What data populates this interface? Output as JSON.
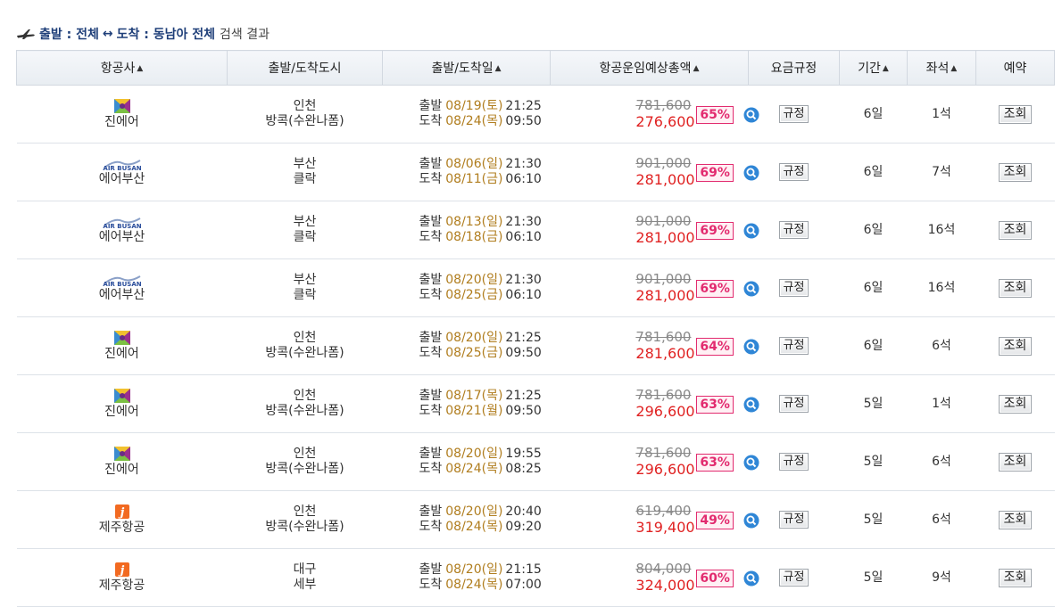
{
  "caption": {
    "departure_label": "출발 : 전체",
    "arrow": "↔",
    "arrival_label": "도착 : 동남아 전체",
    "suffix": "검색 결과"
  },
  "columns": [
    {
      "label": "항공사",
      "sortable": true
    },
    {
      "label": "출발/도착도시",
      "sortable": false
    },
    {
      "label": "출발/도착일",
      "sortable": true
    },
    {
      "label": "항공운임예상총액",
      "sortable": true
    },
    {
      "label": "요금규정",
      "sortable": false
    },
    {
      "label": "기간",
      "sortable": true
    },
    {
      "label": "좌석",
      "sortable": true
    },
    {
      "label": "예약",
      "sortable": false
    }
  ],
  "labels": {
    "depart": "출발",
    "arrive": "도착",
    "rule_button": "규정",
    "view_button": "조회",
    "sort_arrow": "▲"
  },
  "colors": {
    "discount_border": "#e22b6f",
    "final_price": "#e02222",
    "date": "#b07d1e",
    "caption_highlight": "#1f3f79"
  },
  "rows": [
    {
      "airline": "진에어",
      "logo": "jinair-logo",
      "from_city": "인천",
      "to_city": "방콕(수완나폼)",
      "dep_date": "08/19(토)",
      "dep_time": "21:25",
      "arr_date": "08/24(목)",
      "arr_time": "09:50",
      "orig_price": "781,600",
      "price": "276,600",
      "discount": "65%",
      "duration": "6일",
      "seats": "1석"
    },
    {
      "airline": "에어부산",
      "logo": "airbusan-logo",
      "from_city": "부산",
      "to_city": "클락",
      "dep_date": "08/06(일)",
      "dep_time": "21:30",
      "arr_date": "08/11(금)",
      "arr_time": "06:10",
      "orig_price": "901,000",
      "price": "281,000",
      "discount": "69%",
      "duration": "6일",
      "seats": "7석"
    },
    {
      "airline": "에어부산",
      "logo": "airbusan-logo",
      "from_city": "부산",
      "to_city": "클락",
      "dep_date": "08/13(일)",
      "dep_time": "21:30",
      "arr_date": "08/18(금)",
      "arr_time": "06:10",
      "orig_price": "901,000",
      "price": "281,000",
      "discount": "69%",
      "duration": "6일",
      "seats": "16석"
    },
    {
      "airline": "에어부산",
      "logo": "airbusan-logo",
      "from_city": "부산",
      "to_city": "클락",
      "dep_date": "08/20(일)",
      "dep_time": "21:30",
      "arr_date": "08/25(금)",
      "arr_time": "06:10",
      "orig_price": "901,000",
      "price": "281,000",
      "discount": "69%",
      "duration": "6일",
      "seats": "16석"
    },
    {
      "airline": "진에어",
      "logo": "jinair-logo",
      "from_city": "인천",
      "to_city": "방콕(수완나폼)",
      "dep_date": "08/20(일)",
      "dep_time": "21:25",
      "arr_date": "08/25(금)",
      "arr_time": "09:50",
      "orig_price": "781,600",
      "price": "281,600",
      "discount": "64%",
      "duration": "6일",
      "seats": "6석"
    },
    {
      "airline": "진에어",
      "logo": "jinair-logo",
      "from_city": "인천",
      "to_city": "방콕(수완나폼)",
      "dep_date": "08/17(목)",
      "dep_time": "21:25",
      "arr_date": "08/21(월)",
      "arr_time": "09:50",
      "orig_price": "781,600",
      "price": "296,600",
      "discount": "63%",
      "duration": "5일",
      "seats": "1석"
    },
    {
      "airline": "진에어",
      "logo": "jinair-logo",
      "from_city": "인천",
      "to_city": "방콕(수완나폼)",
      "dep_date": "08/20(일)",
      "dep_time": "19:55",
      "arr_date": "08/24(목)",
      "arr_time": "08:25",
      "orig_price": "781,600",
      "price": "296,600",
      "discount": "63%",
      "duration": "5일",
      "seats": "6석"
    },
    {
      "airline": "제주항공",
      "logo": "jejuair-logo",
      "from_city": "인천",
      "to_city": "방콕(수완나폼)",
      "dep_date": "08/20(일)",
      "dep_time": "20:40",
      "arr_date": "08/24(목)",
      "arr_time": "09:20",
      "orig_price": "619,400",
      "price": "319,400",
      "discount": "49%",
      "duration": "5일",
      "seats": "6석"
    },
    {
      "airline": "제주항공",
      "logo": "jejuair-logo",
      "from_city": "대구",
      "to_city": "세부",
      "dep_date": "08/20(일)",
      "dep_time": "21:15",
      "arr_date": "08/24(목)",
      "arr_time": "07:00",
      "orig_price": "804,000",
      "price": "324,000",
      "discount": "60%",
      "duration": "5일",
      "seats": "9석"
    }
  ]
}
